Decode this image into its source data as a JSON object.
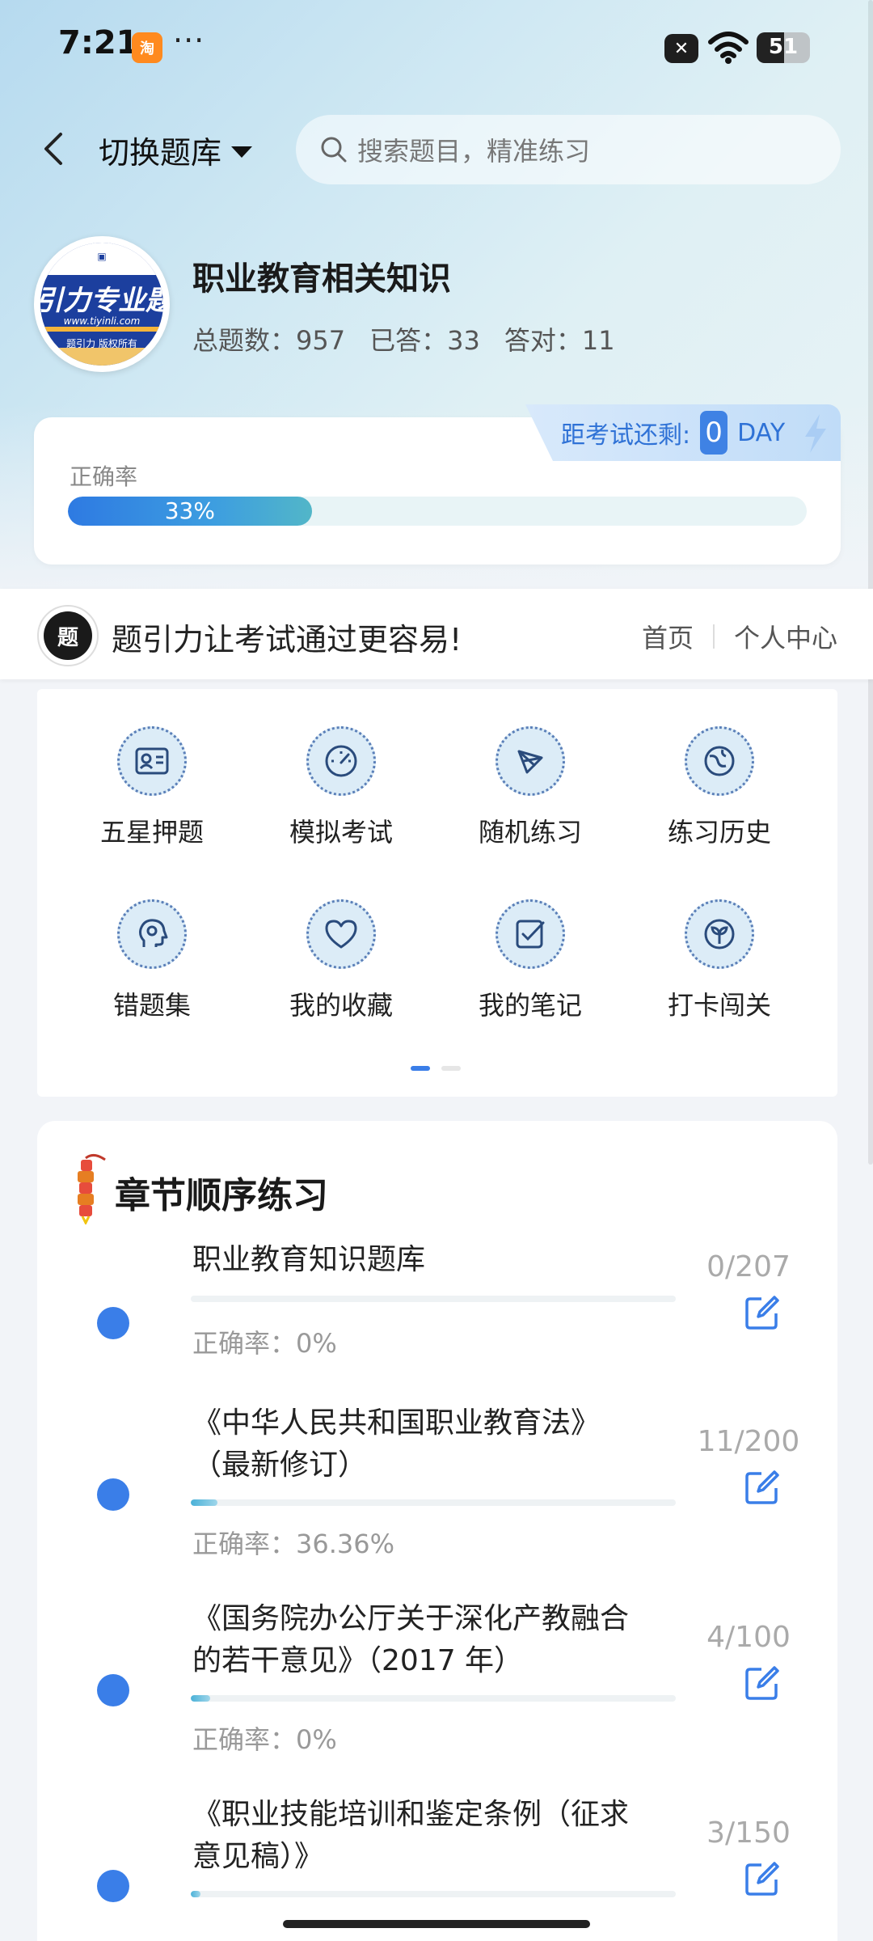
{
  "status_bar": {
    "time": "7:21",
    "more": "···",
    "battery_level": "51",
    "battery_fraction": 0.51
  },
  "header": {
    "switch_bank_label": "切换题库",
    "search_placeholder": "搜索题目，精准练习"
  },
  "profile": {
    "logo_main_text": "引力专业题",
    "logo_url_text": "www.tiyinli.com",
    "logo_copyright": "题引力 版权所有",
    "bank_title": "职业教育相关知识",
    "stats": {
      "total": "总题数：957",
      "answered": "已答：33",
      "correct": "答对：11"
    }
  },
  "countdown": {
    "label": "距考试还剩:",
    "days": "0",
    "unit": "DAY"
  },
  "accuracy": {
    "label": "正确率",
    "percent_text": "33%",
    "fraction": 0.33
  },
  "brand": {
    "slogan": "题引力让考试通过更容易!",
    "nav_home": "首页",
    "nav_profile": "个人中心"
  },
  "grid": {
    "items": [
      {
        "label": "五星押题",
        "icon": "id-card-icon"
      },
      {
        "label": "模拟考试",
        "icon": "speedometer-icon"
      },
      {
        "label": "随机练习",
        "icon": "shuffle-nodes-icon"
      },
      {
        "label": "练习历史",
        "icon": "globe-icon"
      },
      {
        "label": "错题集",
        "icon": "head-icon"
      },
      {
        "label": "我的收藏",
        "icon": "heart-icon"
      },
      {
        "label": "我的笔记",
        "icon": "note-check-icon"
      },
      {
        "label": "打卡闯关",
        "icon": "sprout-icon"
      }
    ],
    "pages": 2,
    "active_page": 1
  },
  "chapters": {
    "title": "章节顺序练习",
    "items": [
      {
        "title_lines": [
          "职业教育知识题库"
        ],
        "accuracy": "正确率：0%",
        "count": "0/207",
        "progress": 0.0
      },
      {
        "title_lines": [
          "《中华人民共和国职业教育法》",
          "（最新修订）"
        ],
        "accuracy": "正确率：36.36%",
        "count": "11/200",
        "progress": 0.055
      },
      {
        "title_lines": [
          "《国务院办公厅关于深化产教融合",
          "的若干意见》（2017 年）"
        ],
        "accuracy": "正确率：0%",
        "count": "4/100",
        "progress": 0.04
      },
      {
        "title_lines": [
          "《职业技能培训和鉴定条例（征求",
          "意见稿）》"
        ],
        "accuracy": "",
        "count": "3/150",
        "progress": 0.02
      }
    ]
  },
  "colors": {
    "accent": "#3a7ee8",
    "progress_start": "#2e7ae2",
    "progress_end": "#52b6c8"
  }
}
